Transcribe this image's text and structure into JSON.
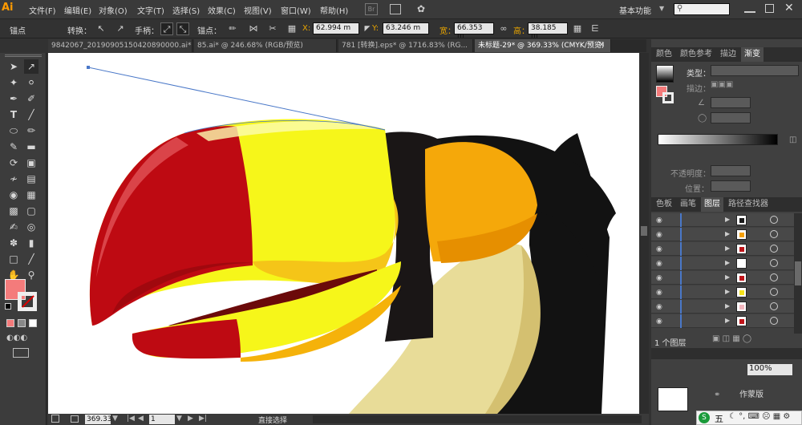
{
  "app": {
    "logo": "Ai",
    "workspace": "基本功能",
    "br": "Br"
  },
  "menu": [
    "文件(F)",
    "编辑(E)",
    "对象(O)",
    "文字(T)",
    "选择(S)",
    "效果(C)",
    "视图(V)",
    "窗口(W)",
    "帮助(H)"
  ],
  "control": {
    "mode": "锚点",
    "convert": "转换：",
    "handles": "手柄：",
    "anchor": "锚点：",
    "x_label": "X:",
    "x": "62.994 m",
    "y_label": "Y:",
    "y": "63.246 m",
    "w_label": "宽：",
    "w": "66.353 m",
    "h_label": "高：",
    "h": "38.185 m"
  },
  "tabs": [
    "9842067_20190905150420890000.ai* @...",
    "85.ai* @ 246.68% (RGB/预览)",
    "781 [转换].eps* @ 1716.83% (RG...",
    "未标题-29* @ 369.33% (CMYK/预览)"
  ],
  "status": {
    "zoom": "369.33",
    "page": "1",
    "tool": "直接选择"
  },
  "panel": {
    "top_tabs": [
      "颜色",
      "颜色参考",
      "描边",
      "渐变"
    ],
    "type_label": "类型：",
    "stroke_label": "描边：",
    "opacity_label": "不透明度：",
    "position_label": "位置：",
    "layer_tabs": [
      "色板",
      "画笔",
      "图层",
      "路径查找器"
    ],
    "layer_count": "1 个图层",
    "bottom_percent": "100%",
    "artboard_btn": "作蒙版"
  },
  "layer_thumbs": [
    "#1a1a1a",
    "#f5a00a",
    "#c0151a",
    "#ffffff",
    "#c0151a",
    "#f5e21a",
    "#f4b8c0",
    "#c0151a"
  ],
  "ime": {
    "label": "五"
  },
  "colors": {
    "fill": "#f47b7b",
    "accent": "#ff9a00",
    "beak_red": "#be0a12",
    "beak_yellow": "#f6f61a",
    "orange": "#f5a80a"
  }
}
